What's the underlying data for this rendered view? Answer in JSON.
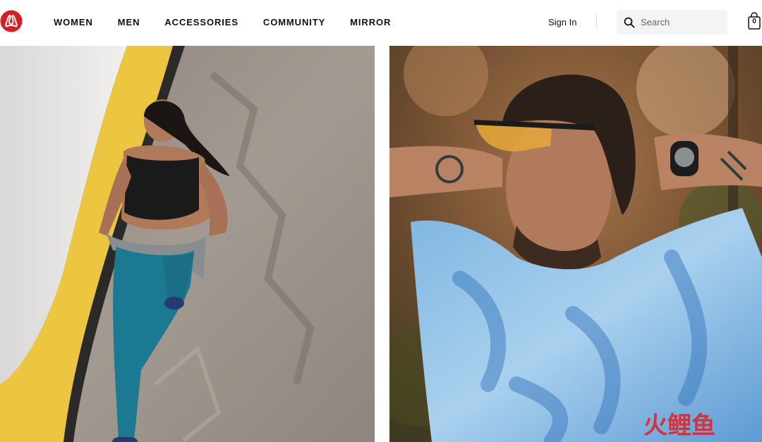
{
  "header": {
    "logo_icon": "lululemon-logo-icon",
    "brand_color": "#d31f26",
    "nav": [
      {
        "label": "WOMEN"
      },
      {
        "label": "MEN"
      },
      {
        "label": "ACCESSORIES"
      },
      {
        "label": "COMMUNITY"
      },
      {
        "label": "MIRROR"
      }
    ],
    "sign_in_label": "Sign In",
    "search": {
      "placeholder": "Search",
      "value": "",
      "icon": "search-icon"
    },
    "bag": {
      "icon": "shopping-bag-icon",
      "count": "0"
    }
  },
  "hero": {
    "left_image": "woman-running-photo",
    "right_image": "man-tie-dye-shirt-photo"
  },
  "watermark": {
    "text": "火鲤鱼",
    "color": "#e0262e"
  }
}
